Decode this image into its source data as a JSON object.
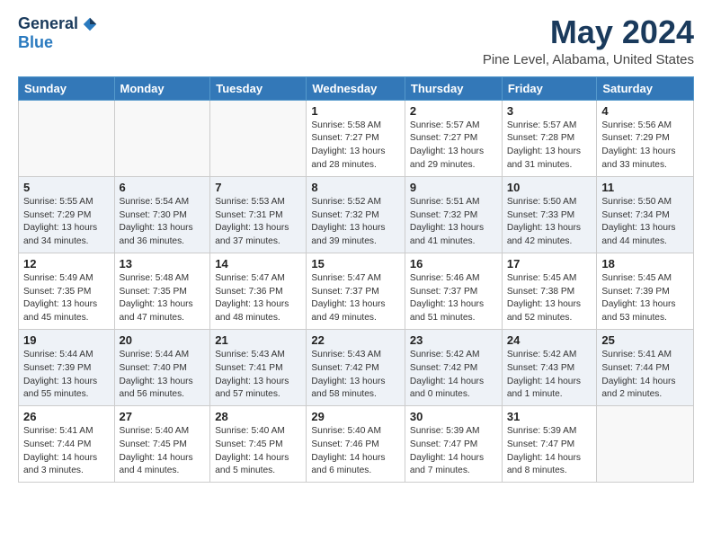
{
  "logo": {
    "general": "General",
    "blue": "Blue"
  },
  "title": "May 2024",
  "subtitle": "Pine Level, Alabama, United States",
  "weekdays": [
    "Sunday",
    "Monday",
    "Tuesday",
    "Wednesday",
    "Thursday",
    "Friday",
    "Saturday"
  ],
  "weeks": [
    [
      {
        "day": "",
        "info": ""
      },
      {
        "day": "",
        "info": ""
      },
      {
        "day": "",
        "info": ""
      },
      {
        "day": "1",
        "info": "Sunrise: 5:58 AM\nSunset: 7:27 PM\nDaylight: 13 hours\nand 28 minutes."
      },
      {
        "day": "2",
        "info": "Sunrise: 5:57 AM\nSunset: 7:27 PM\nDaylight: 13 hours\nand 29 minutes."
      },
      {
        "day": "3",
        "info": "Sunrise: 5:57 AM\nSunset: 7:28 PM\nDaylight: 13 hours\nand 31 minutes."
      },
      {
        "day": "4",
        "info": "Sunrise: 5:56 AM\nSunset: 7:29 PM\nDaylight: 13 hours\nand 33 minutes."
      }
    ],
    [
      {
        "day": "5",
        "info": "Sunrise: 5:55 AM\nSunset: 7:29 PM\nDaylight: 13 hours\nand 34 minutes."
      },
      {
        "day": "6",
        "info": "Sunrise: 5:54 AM\nSunset: 7:30 PM\nDaylight: 13 hours\nand 36 minutes."
      },
      {
        "day": "7",
        "info": "Sunrise: 5:53 AM\nSunset: 7:31 PM\nDaylight: 13 hours\nand 37 minutes."
      },
      {
        "day": "8",
        "info": "Sunrise: 5:52 AM\nSunset: 7:32 PM\nDaylight: 13 hours\nand 39 minutes."
      },
      {
        "day": "9",
        "info": "Sunrise: 5:51 AM\nSunset: 7:32 PM\nDaylight: 13 hours\nand 41 minutes."
      },
      {
        "day": "10",
        "info": "Sunrise: 5:50 AM\nSunset: 7:33 PM\nDaylight: 13 hours\nand 42 minutes."
      },
      {
        "day": "11",
        "info": "Sunrise: 5:50 AM\nSunset: 7:34 PM\nDaylight: 13 hours\nand 44 minutes."
      }
    ],
    [
      {
        "day": "12",
        "info": "Sunrise: 5:49 AM\nSunset: 7:35 PM\nDaylight: 13 hours\nand 45 minutes."
      },
      {
        "day": "13",
        "info": "Sunrise: 5:48 AM\nSunset: 7:35 PM\nDaylight: 13 hours\nand 47 minutes."
      },
      {
        "day": "14",
        "info": "Sunrise: 5:47 AM\nSunset: 7:36 PM\nDaylight: 13 hours\nand 48 minutes."
      },
      {
        "day": "15",
        "info": "Sunrise: 5:47 AM\nSunset: 7:37 PM\nDaylight: 13 hours\nand 49 minutes."
      },
      {
        "day": "16",
        "info": "Sunrise: 5:46 AM\nSunset: 7:37 PM\nDaylight: 13 hours\nand 51 minutes."
      },
      {
        "day": "17",
        "info": "Sunrise: 5:45 AM\nSunset: 7:38 PM\nDaylight: 13 hours\nand 52 minutes."
      },
      {
        "day": "18",
        "info": "Sunrise: 5:45 AM\nSunset: 7:39 PM\nDaylight: 13 hours\nand 53 minutes."
      }
    ],
    [
      {
        "day": "19",
        "info": "Sunrise: 5:44 AM\nSunset: 7:39 PM\nDaylight: 13 hours\nand 55 minutes."
      },
      {
        "day": "20",
        "info": "Sunrise: 5:44 AM\nSunset: 7:40 PM\nDaylight: 13 hours\nand 56 minutes."
      },
      {
        "day": "21",
        "info": "Sunrise: 5:43 AM\nSunset: 7:41 PM\nDaylight: 13 hours\nand 57 minutes."
      },
      {
        "day": "22",
        "info": "Sunrise: 5:43 AM\nSunset: 7:42 PM\nDaylight: 13 hours\nand 58 minutes."
      },
      {
        "day": "23",
        "info": "Sunrise: 5:42 AM\nSunset: 7:42 PM\nDaylight: 14 hours\nand 0 minutes."
      },
      {
        "day": "24",
        "info": "Sunrise: 5:42 AM\nSunset: 7:43 PM\nDaylight: 14 hours\nand 1 minute."
      },
      {
        "day": "25",
        "info": "Sunrise: 5:41 AM\nSunset: 7:44 PM\nDaylight: 14 hours\nand 2 minutes."
      }
    ],
    [
      {
        "day": "26",
        "info": "Sunrise: 5:41 AM\nSunset: 7:44 PM\nDaylight: 14 hours\nand 3 minutes."
      },
      {
        "day": "27",
        "info": "Sunrise: 5:40 AM\nSunset: 7:45 PM\nDaylight: 14 hours\nand 4 minutes."
      },
      {
        "day": "28",
        "info": "Sunrise: 5:40 AM\nSunset: 7:45 PM\nDaylight: 14 hours\nand 5 minutes."
      },
      {
        "day": "29",
        "info": "Sunrise: 5:40 AM\nSunset: 7:46 PM\nDaylight: 14 hours\nand 6 minutes."
      },
      {
        "day": "30",
        "info": "Sunrise: 5:39 AM\nSunset: 7:47 PM\nDaylight: 14 hours\nand 7 minutes."
      },
      {
        "day": "31",
        "info": "Sunrise: 5:39 AM\nSunset: 7:47 PM\nDaylight: 14 hours\nand 8 minutes."
      },
      {
        "day": "",
        "info": ""
      }
    ]
  ]
}
